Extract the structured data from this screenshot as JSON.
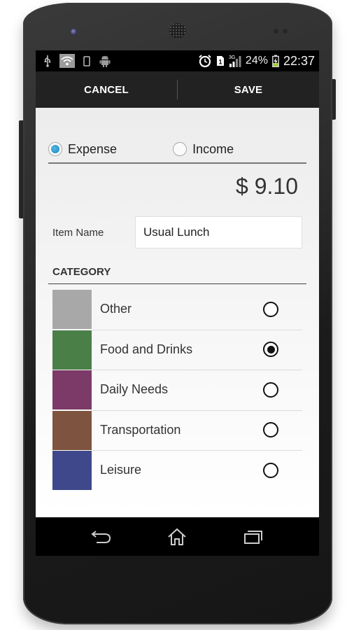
{
  "statusbar": {
    "left_icons": [
      "usb-icon",
      "wifi-icon",
      "phone-outline-icon",
      "android-icon"
    ],
    "right_icons": [
      "alarm-icon",
      "sim-icon",
      "signal-icon",
      "battery-charging-icon"
    ],
    "network_type": "3G",
    "sim_slot": "1",
    "battery_percent": "24%",
    "time": "22:37"
  },
  "actionbar": {
    "cancel_label": "CANCEL",
    "save_label": "SAVE"
  },
  "transaction_type": {
    "options": [
      {
        "label": "Expense",
        "selected": true
      },
      {
        "label": "Income",
        "selected": false
      }
    ],
    "accent_color": "#33b5e5"
  },
  "amount": {
    "display": "$ 9.10",
    "currency_symbol": "$",
    "value": "9.10"
  },
  "item_name": {
    "label": "Item Name",
    "value": "Usual Lunch"
  },
  "category": {
    "header": "CATEGORY",
    "items": [
      {
        "label": "Other",
        "color": "#a8a8a8",
        "selected": false
      },
      {
        "label": "Food and Drinks",
        "color": "#4a8048",
        "selected": true
      },
      {
        "label": "Daily Needs",
        "color": "#7c3a68",
        "selected": false
      },
      {
        "label": "Transportation",
        "color": "#7e5440",
        "selected": false
      },
      {
        "label": "Leisure",
        "color": "#3e488a",
        "selected": false
      }
    ]
  },
  "navbar": {
    "buttons": [
      "back-icon",
      "home-icon",
      "recent-apps-icon"
    ]
  }
}
